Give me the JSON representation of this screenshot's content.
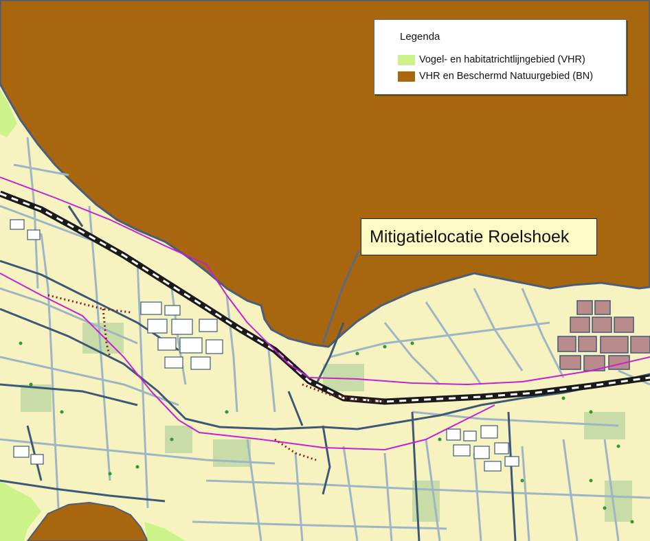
{
  "legend": {
    "title": "Legenda",
    "items": [
      {
        "label": "Vogel- en habitatrichtlijngebied (VHR)",
        "color": "#ccf28a"
      },
      {
        "label": "VHR en Beschermd Natuurgebied (BN)",
        "color": "#a8670f"
      }
    ]
  },
  "callout": {
    "label": "Mitigatielocatie Roelshoek"
  },
  "colors": {
    "water_protected": "#a8670f",
    "land": "#f7f3c0",
    "vhr_green": "#ccf28a",
    "meadow": "#c8dca8",
    "ditch": "#9db6c6",
    "road": "#3d5877",
    "railway": "#1a1a1a",
    "route_line": "#c81fd1",
    "industry": "#b98b8b",
    "trees": "#2e9a2e"
  }
}
